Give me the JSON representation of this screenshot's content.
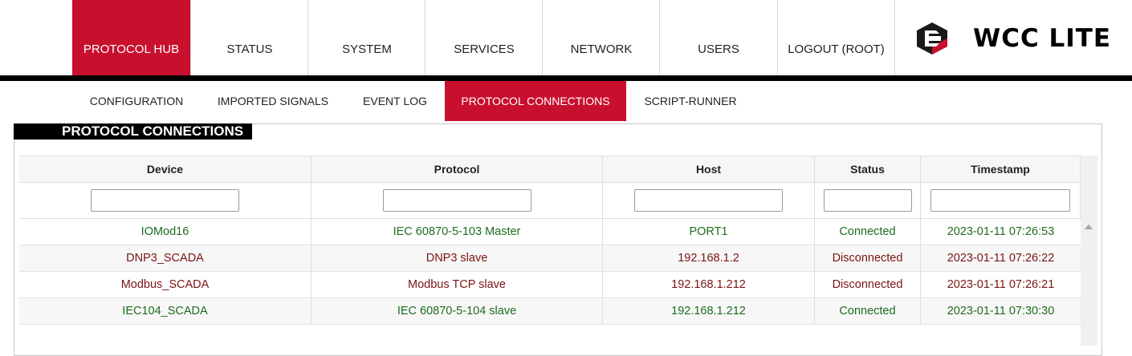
{
  "nav": {
    "items": [
      {
        "label": "PROTOCOL HUB",
        "active": true
      },
      {
        "label": "STATUS"
      },
      {
        "label": "SYSTEM"
      },
      {
        "label": "SERVICES"
      },
      {
        "label": "NETWORK"
      },
      {
        "label": "USERS"
      },
      {
        "label": "LOGOUT (ROOT)"
      }
    ],
    "brand": "WCC LITE",
    "logo_icon": "wcc-logo-icon"
  },
  "subnav": {
    "items": [
      {
        "label": "CONFIGURATION"
      },
      {
        "label": "IMPORTED SIGNALS"
      },
      {
        "label": "EVENT LOG"
      },
      {
        "label": "PROTOCOL CONNECTIONS",
        "active": true
      },
      {
        "label": "SCRIPT-RUNNER"
      }
    ]
  },
  "panel": {
    "title": "PROTOCOL CONNECTIONS"
  },
  "table": {
    "columns": [
      "Device",
      "Protocol",
      "Host",
      "Status",
      "Timestamp"
    ],
    "filters": [
      "",
      "",
      "",
      "",
      ""
    ],
    "rows": [
      {
        "device": "IOMod16",
        "protocol": "IEC 60870-5-103 Master",
        "host": "PORT1",
        "status": "Connected",
        "timestamp": "2023-01-11 07:26:53"
      },
      {
        "device": "DNP3_SCADA",
        "protocol": "DNP3 slave",
        "host": "192.168.1.2",
        "status": "Disconnected",
        "timestamp": "2023-01-11 07:26:22"
      },
      {
        "device": "Modbus_SCADA",
        "protocol": "Modbus TCP slave",
        "host": "192.168.1.212",
        "status": "Disconnected",
        "timestamp": "2023-01-11 07:26:21"
      },
      {
        "device": "IEC104_SCADA",
        "protocol": "IEC 60870-5-104 slave",
        "host": "192.168.1.212",
        "status": "Connected",
        "timestamp": "2023-01-11 07:30:30"
      }
    ]
  },
  "colors": {
    "accent": "#c8102e",
    "connected": "#1e6b1e",
    "disconnected": "#7a1414"
  }
}
